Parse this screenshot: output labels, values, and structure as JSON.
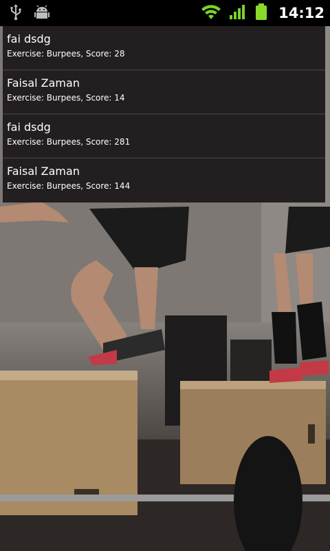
{
  "status_bar": {
    "time": "14:12",
    "icons": [
      "usb-icon",
      "android-debug-icon",
      "wifi-icon",
      "signal-icon",
      "battery-icon"
    ]
  },
  "background": {
    "description_icon": "gym-photo"
  },
  "scores": [
    {
      "name": "fai dsdg",
      "detail": "Exercise: Burpees, Score: 28"
    },
    {
      "name": "Faisal Zaman",
      "detail": "Exercise: Burpees, Score: 14"
    },
    {
      "name": "fai dsdg",
      "detail": "Exercise: Burpees, Score: 281"
    },
    {
      "name": "Faisal Zaman",
      "detail": "Exercise: Burpees, Score: 144"
    }
  ],
  "colors": {
    "list_background": "#231f20",
    "divider": "#4a4a4a",
    "wifi_green": "#7ad42a",
    "battery_green": "#8ad82a"
  }
}
